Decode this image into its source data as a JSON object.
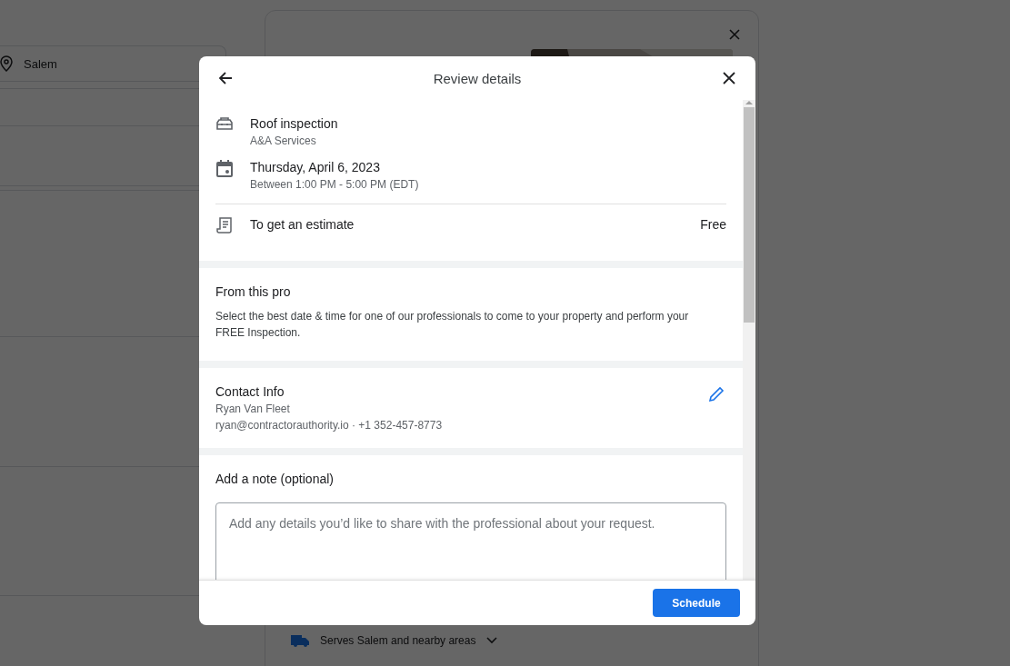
{
  "background": {
    "location_field": {
      "value": "Salem"
    },
    "service_area": "Serves Salem and nearby areas"
  },
  "dialog": {
    "title": "Review details",
    "summary": [
      {
        "kind": "service",
        "title": "Roof inspection",
        "subtitle": "A&A Services"
      },
      {
        "kind": "date",
        "title": "Thursday, April 6, 2023",
        "subtitle": "Between 1:00 PM - 5:00 PM (EDT)"
      }
    ],
    "estimate": {
      "label": "To get an estimate",
      "price": "Free"
    },
    "from_pro": {
      "heading": "From this pro",
      "text": "Select the best date & time for one of our professionals to come to your property and perform your FREE Inspection."
    },
    "contact": {
      "heading": "Contact Info",
      "name": "Ryan Van Fleet",
      "details": "ryan@contractorauthority.io · +1 352-457-8773"
    },
    "note": {
      "heading": "Add a note (optional)",
      "placeholder": "Add any details you’d like to share with the professional about your request."
    },
    "buttons": [
      {
        "label": "Schedule"
      }
    ]
  }
}
